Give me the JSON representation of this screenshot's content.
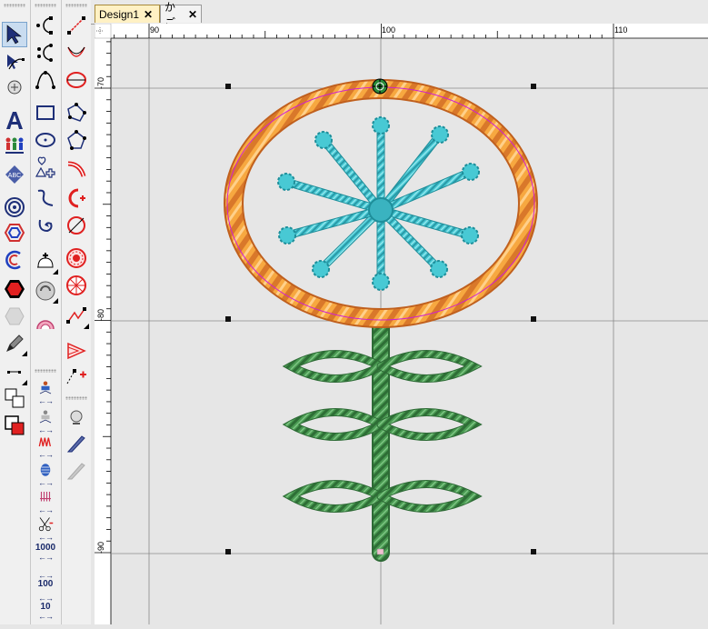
{
  "tabs": [
    {
      "label": "Design1",
      "close": "✕",
      "active": true
    },
    {
      "label": "かご",
      "close": "✕",
      "active": false
    }
  ],
  "ruler": {
    "top_labels": [
      "90",
      "100",
      "110"
    ],
    "left_labels": [
      "-70",
      "-80",
      "-90"
    ]
  },
  "toolbox": {
    "stitch_values": [
      "1000",
      "100",
      "10"
    ]
  },
  "colors": {
    "canvas": "#e6e6e6",
    "grid": "#8a8a8a",
    "flower_ring": "#f5a23a",
    "flower_spokes": "#3fc3d0",
    "stem": "#3e8a48",
    "selection_outline": "#d020d0",
    "tab_active": "#fff1c4"
  }
}
